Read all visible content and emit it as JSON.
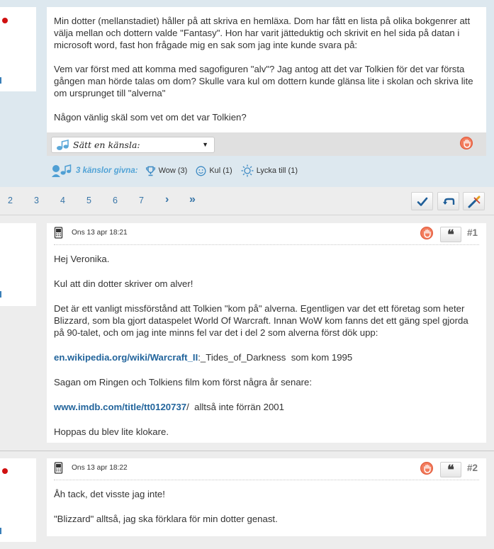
{
  "original_post": {
    "paragraphs": [
      "Min dotter (mellanstadiet) håller på att skriva en hemläxa. Dom har fått en lista på olika bokgenrer att välja mellan och dottern valde \"Fantasy\". Hon har varit jätteduktig och skrivit en hel sida på datan i microsoft word, fast hon frågade mig en sak som jag inte kunde svara på:",
      "Vem var först med att komma med sagofiguren \"alv\"? Jag antog att det var Tolkien för det var första gången man hörde talas om dom? Skulle vara kul om dottern kunde glänsa lite i skolan och skriva lite om ursprunget till \"alverna\"",
      "Någon vänlig skäl som vet om det var Tolkien?"
    ],
    "feeling_select": "Sätt en känsla:",
    "feelings_count_label": "3 känslor givna:",
    "feelings": [
      {
        "icon": "trophy-icon",
        "label": "Wow (3)"
      },
      {
        "icon": "smiley-icon",
        "label": "Kul (1)"
      },
      {
        "icon": "sun-icon",
        "label": "Lycka till (1)"
      }
    ]
  },
  "pagination": {
    "pages": [
      "2",
      "3",
      "4",
      "5",
      "6",
      "7"
    ],
    "next": "›",
    "last": "»"
  },
  "replies": [
    {
      "date": "Ons 13 apr 18:21",
      "number": "#1",
      "quote": "❝",
      "p1": "Hej Veronika.",
      "p2": "Kul att din dotter skriver om alver!",
      "p3": "Det är ett vanligt missförstånd att Tolkien \"kom på\" alverna. Egentligen var det ett företag som heter Blizzard, som bla gjort dataspelet World Of Warcraft. Innan WoW kom fanns det ett gäng spel gjorda på 90-talet, och om jag inte minns fel var det i del 2 som alverna först dök upp:",
      "link1": "en.wikipedia.org/wiki/Warcraft_II",
      "link1_rest": ":_Tides_of_Darkness  som kom 1995",
      "p5": "Sagan om Ringen och Tolkiens film kom först några år senare:",
      "link2": "www.imdb.com/title/tt0120737",
      "link2_rest": "/  alltså inte förrän 2001",
      "p7": "Hoppas du blev lite klokare."
    },
    {
      "date": "Ons 13 apr 18:22",
      "number": "#2",
      "quote": "❝",
      "p1": "Åh tack, det visste jag inte!",
      "p2": "\"Blizzard\" alltså, jag ska förklara för min dotter genast."
    }
  ],
  "colors": {
    "link": "#23659c",
    "page_number": "#3976a8",
    "feeling_accent": "#52a3d6",
    "report_badge": "#f27b5c",
    "online_dot": "#d01010"
  }
}
